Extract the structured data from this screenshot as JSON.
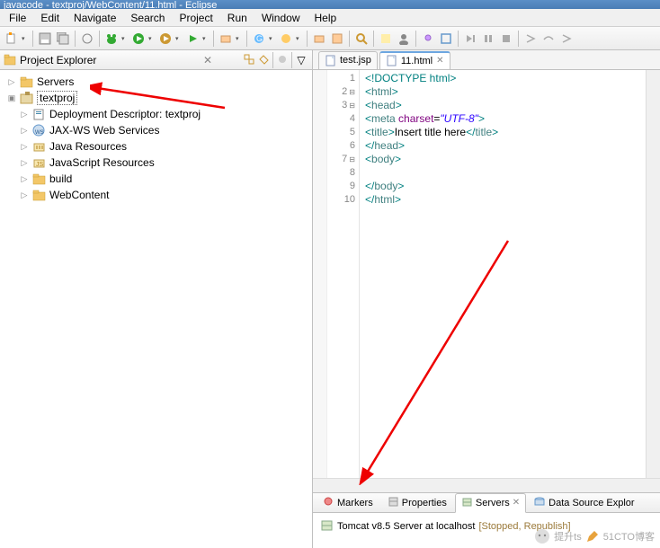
{
  "title_bar": "javacode - textproj/WebContent/11.html - Eclipse",
  "menu": [
    "File",
    "Edit",
    "Navigate",
    "Search",
    "Project",
    "Run",
    "Window",
    "Help"
  ],
  "explorer": {
    "title": "Project Explorer",
    "nodes": [
      {
        "label": "Servers",
        "icon": "folder",
        "expandable": true
      },
      {
        "label": "textproj",
        "icon": "project",
        "expandable": true,
        "selected": true,
        "children": [
          {
            "label": "Deployment Descriptor: textproj",
            "icon": "dd"
          },
          {
            "label": "JAX-WS Web Services",
            "icon": "jaxws"
          },
          {
            "label": "Java Resources",
            "icon": "jres"
          },
          {
            "label": "JavaScript Resources",
            "icon": "jsres"
          },
          {
            "label": "build",
            "icon": "folder"
          },
          {
            "label": "WebContent",
            "icon": "folder"
          }
        ]
      }
    ]
  },
  "editor": {
    "tabs": [
      {
        "label": "test.jsp",
        "active": false
      },
      {
        "label": "11.html",
        "active": true
      }
    ]
  },
  "code_lines": [
    {
      "n": 1,
      "html": "<span class='doctype'>&lt;!DOCTYPE html&gt;</span>"
    },
    {
      "n": 2,
      "fold": true,
      "html": "<span class='tag-bracket'>&lt;</span><span class='tag-name'>html</span><span class='tag-bracket'>&gt;</span>"
    },
    {
      "n": 3,
      "fold": true,
      "html": "<span class='tag-bracket'>&lt;</span><span class='tag-name'>head</span><span class='tag-bracket'>&gt;</span>"
    },
    {
      "n": 4,
      "html": "<span class='tag-bracket'>&lt;</span><span class='tag-name'>meta</span> <span class='attr-name'>charset</span>=<span class='attr-val'>\"UTF-8\"</span><span class='tag-bracket'>&gt;</span>"
    },
    {
      "n": 5,
      "html": "<span class='tag-bracket'>&lt;</span><span class='tag-name'>title</span><span class='tag-bracket'>&gt;</span><span class='text-content'>Insert title here</span><span class='tag-bracket'>&lt;/</span><span class='tag-name'>title</span><span class='tag-bracket'>&gt;</span>"
    },
    {
      "n": 6,
      "html": "<span class='tag-bracket'>&lt;/</span><span class='tag-name'>head</span><span class='tag-bracket'>&gt;</span>"
    },
    {
      "n": 7,
      "fold": true,
      "html": "<span class='tag-bracket'>&lt;</span><span class='tag-name'>body</span><span class='tag-bracket'>&gt;</span>"
    },
    {
      "n": 8,
      "html": ""
    },
    {
      "n": 9,
      "html": "<span class='tag-bracket'>&lt;/</span><span class='tag-name'>body</span><span class='tag-bracket'>&gt;</span>"
    },
    {
      "n": 10,
      "html": "<span class='tag-bracket'>&lt;/</span><span class='tag-name'>html</span><span class='tag-bracket'>&gt;</span>"
    }
  ],
  "bottom": {
    "tabs": [
      {
        "label": "Markers",
        "icon": "markers"
      },
      {
        "label": "Properties",
        "icon": "props"
      },
      {
        "label": "Servers",
        "icon": "servers",
        "active": true
      },
      {
        "label": "Data Source Explor",
        "icon": "dse"
      }
    ],
    "server_name": "Tomcat v8.5 Server at localhost",
    "server_status": "[Stopped, Republish]"
  },
  "watermark": {
    "prefix": "提升ts",
    "suffix": "51CTO博客"
  }
}
